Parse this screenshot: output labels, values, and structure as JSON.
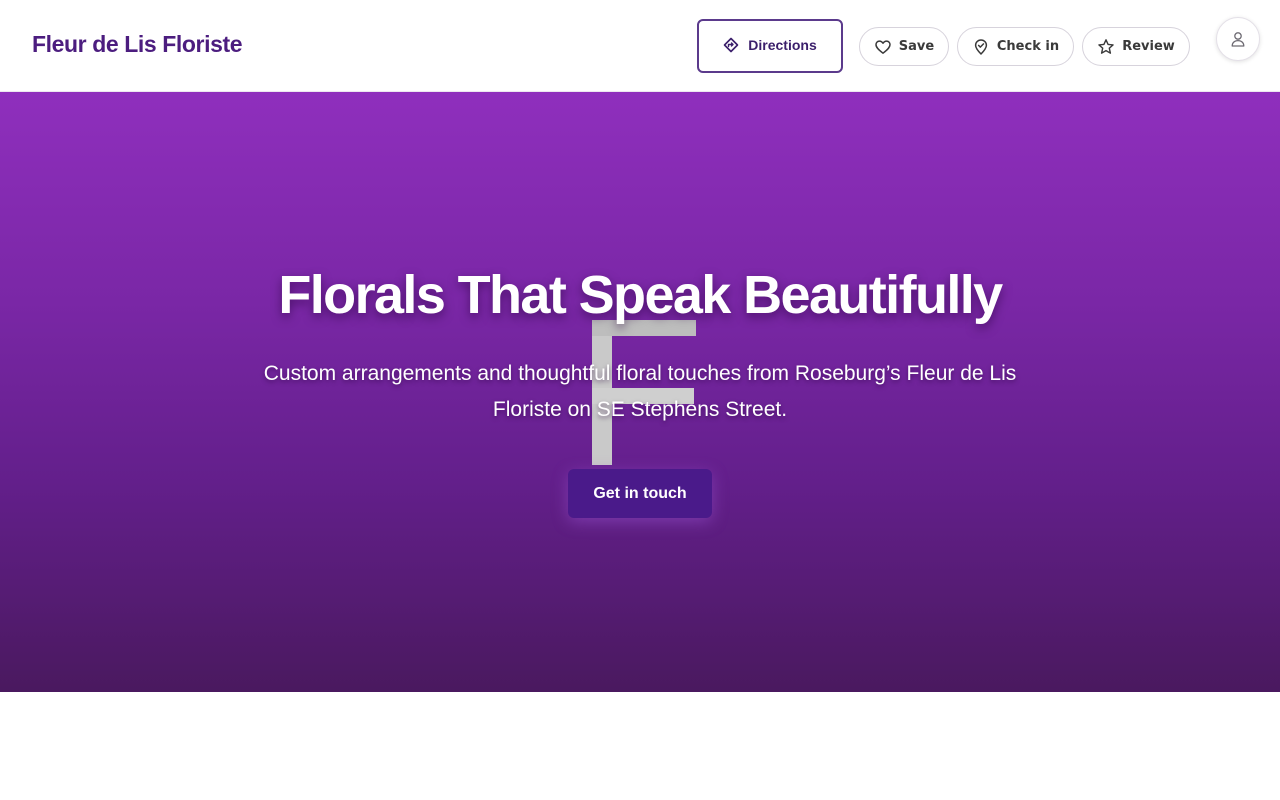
{
  "header": {
    "brand": "Fleur de Lis Floriste",
    "directions_label": "Directions",
    "save_label": "Save",
    "checkin_label": "Check in",
    "review_label": "Review"
  },
  "hero": {
    "title": "Florals That Speak Beautifully",
    "subtitle": "Custom arrangements and thoughtful floral touches from Roseburg’s Fleur de Lis Floriste on SE Stephens Street.",
    "cta_label": "Get in touch"
  },
  "icons": {
    "directions": "directions-icon",
    "save": "heart-icon",
    "checkin": "map-pin-icon",
    "review": "star-icon",
    "account": "user-icon"
  },
  "colors": {
    "brand": "#4c1d7f",
    "hero_top": "#8f2fbd",
    "hero_bottom": "#4a195f",
    "cta": "#4a1a8a"
  }
}
